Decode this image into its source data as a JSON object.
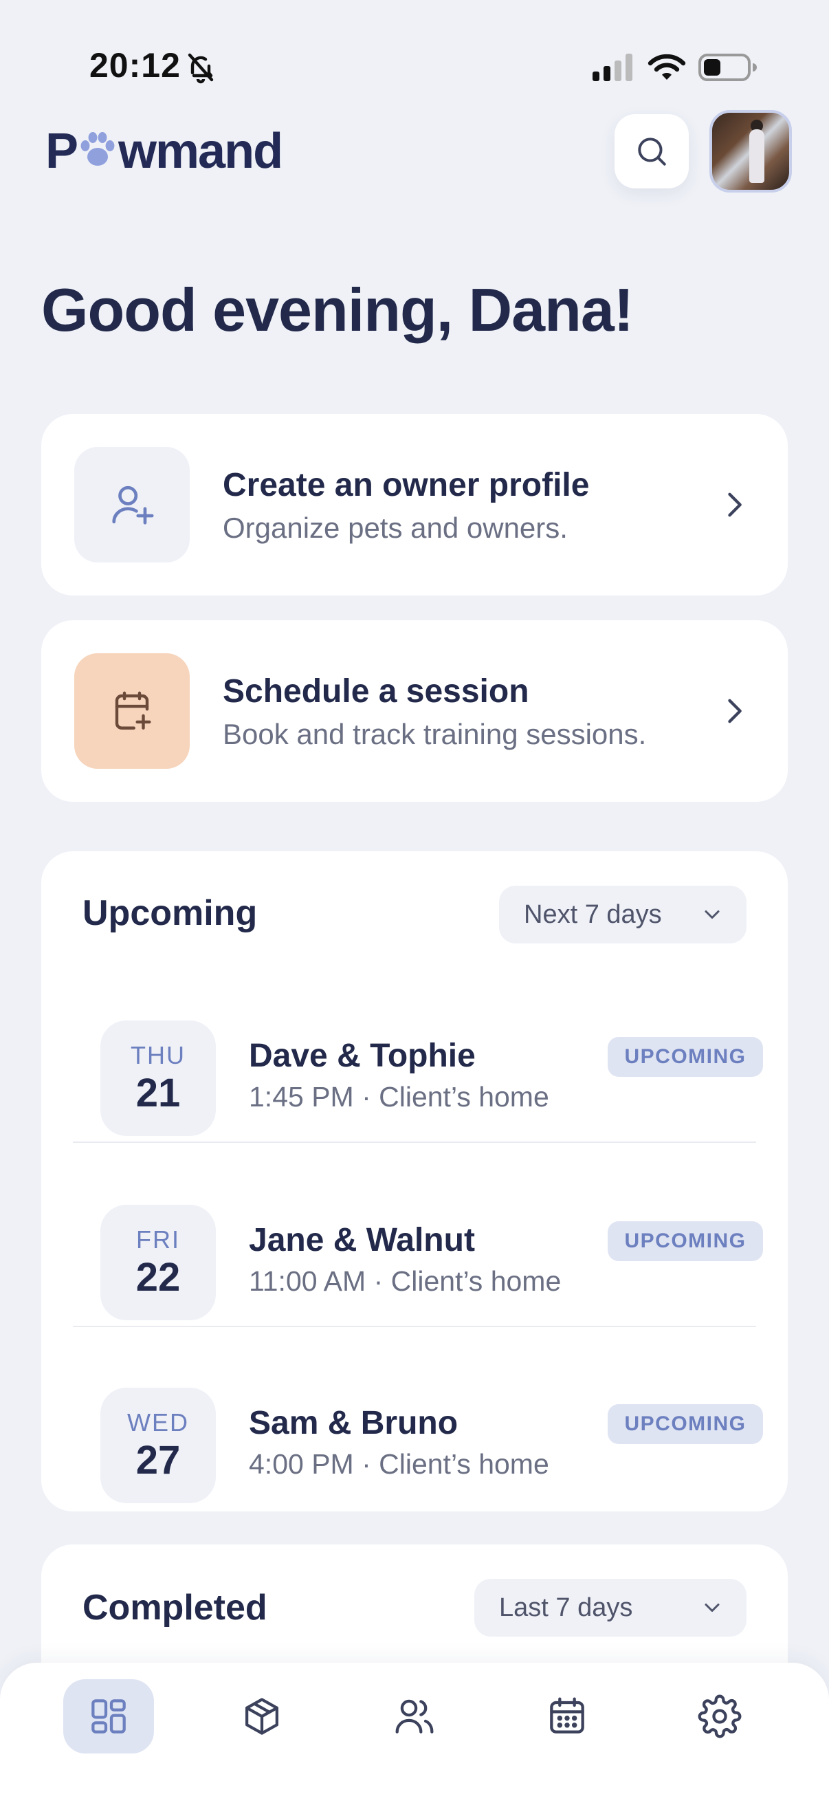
{
  "status_bar": {
    "time": "20:12"
  },
  "header": {
    "logo_text_before": "P",
    "logo_text_after": "wmand"
  },
  "greeting": "Good evening, Dana!",
  "actions": [
    {
      "title": "Create an owner profile",
      "subtitle": "Organize pets and owners.",
      "icon": "user-plus-icon",
      "icon_bg": "#eff1f7"
    },
    {
      "title": "Schedule a session",
      "subtitle": "Book and track training sessions.",
      "icon": "calendar-plus-icon",
      "icon_bg": "#f6d5bc"
    }
  ],
  "upcoming": {
    "title": "Upcoming",
    "filter": "Next 7 days",
    "items": [
      {
        "dow": "THU",
        "day": "21",
        "name": "Dave & Tophie",
        "meta": "1:45 PM · Client’s home",
        "status": "UPCOMING"
      },
      {
        "dow": "FRI",
        "day": "22",
        "name": "Jane & Walnut",
        "meta": "11:00 AM · Client’s home",
        "status": "UPCOMING"
      },
      {
        "dow": "WED",
        "day": "27",
        "name": "Sam & Bruno",
        "meta": "4:00 PM · Client’s home",
        "status": "UPCOMING"
      }
    ]
  },
  "completed": {
    "title": "Completed",
    "filter": "Last 7 days"
  },
  "nav": [
    {
      "icon": "dashboard-icon",
      "active": true
    },
    {
      "icon": "box-icon",
      "active": false
    },
    {
      "icon": "users-icon",
      "active": false
    },
    {
      "icon": "calendar-icon",
      "active": false
    },
    {
      "icon": "settings-icon",
      "active": false
    }
  ],
  "colors": {
    "accent": "#6c7fbf",
    "primary_text": "#22294a",
    "background": "#eff1f7",
    "peach": "#f6d5bc"
  }
}
